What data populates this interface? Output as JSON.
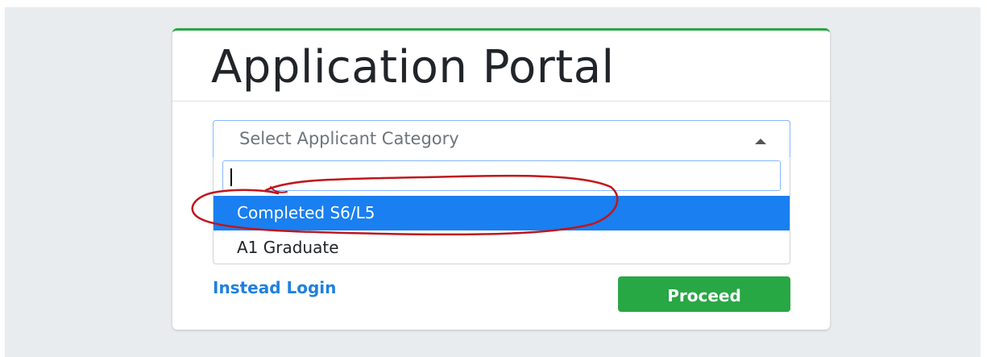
{
  "portal": {
    "title": "Application Portal"
  },
  "category_select": {
    "placeholder": "Select Applicant Category",
    "search_value": "",
    "options": [
      {
        "label": "Completed S6/L5",
        "highlighted": true
      },
      {
        "label": "A1 Graduate",
        "highlighted": false
      }
    ]
  },
  "footer": {
    "login_link": "Instead Login",
    "proceed_label": "Proceed"
  },
  "colors": {
    "accent_green": "#28a745",
    "highlight_blue": "#1a7ff0",
    "link_blue": "#1f80e0",
    "annotation_red": "#c0161c"
  }
}
